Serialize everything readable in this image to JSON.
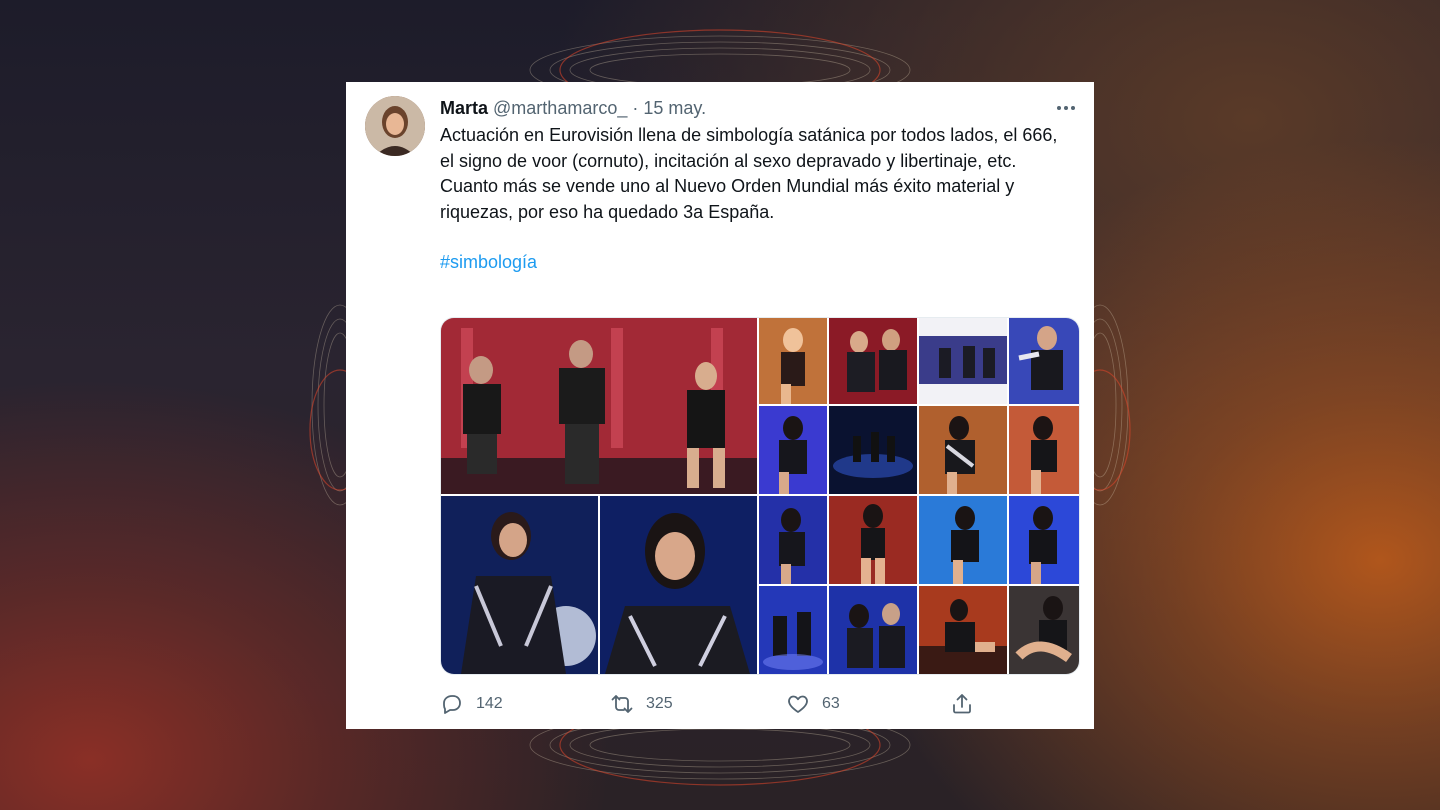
{
  "tweet": {
    "author_name": "Marta",
    "author_handle": "@marthamarco_",
    "separator": "·",
    "date": "15 may.",
    "text_lines": [
      "Actuación en Eurovisión llena de simbología satánica por todos lados, el 666, el signo de voor (cornuto), incitación al sexo depravado y libertinaje, etc.",
      "Cuanto más se vende uno al Nuevo Orden Mundial más éxito material y riquezas, por eso ha quedado 3a España."
    ],
    "hashtag": "#simbología",
    "stats": {
      "replies": "142",
      "retweets": "325",
      "likes": "63"
    }
  },
  "icons": {
    "more": "more-horizontal-icon",
    "reply": "reply-icon",
    "retweet": "retweet-icon",
    "like": "heart-icon",
    "share": "share-icon"
  },
  "colors": {
    "link": "#1d9bf0",
    "text": "#0f1419",
    "muted": "#536471"
  }
}
